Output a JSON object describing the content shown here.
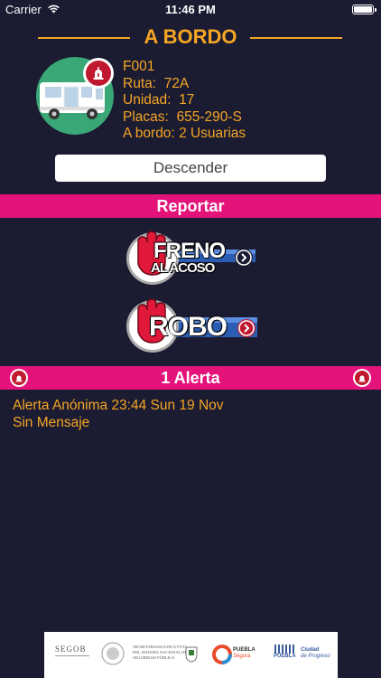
{
  "status_bar": {
    "carrier": "Carrier",
    "time": "11:46 PM"
  },
  "header": {
    "title": "A BORDO"
  },
  "trip": {
    "code": "F001",
    "ruta_label": "Ruta:",
    "ruta": "72A",
    "unidad_label": "Unidad:",
    "unidad": "17",
    "placas_label": "Placas:",
    "placas": "655-290-S",
    "abordo_label": "A bordo:",
    "abordo": "2 Usuarias"
  },
  "actions": {
    "descender": "Descender"
  },
  "report": {
    "title": "Reportar",
    "freno_line1": "FRENO",
    "freno_line2": "AL ACOSO",
    "robo": "ROBO"
  },
  "alerts": {
    "count_label": "1 Alerta",
    "items": [
      {
        "line1": "Alerta Anónima 23:44 Sun 19 Nov",
        "line2": "Sin Mensaje"
      }
    ]
  },
  "footer": {
    "logos": {
      "segob": "SEGOB",
      "secretariado_1": "SECRETARIADO EJECUTIVO",
      "secretariado_2": "DEL SISTEMA NACIONAL DE",
      "secretariado_3": "SEGURIDAD PÚBLICA",
      "puebla_segura_1": "PUEBLA",
      "puebla_segura_2": "Segura",
      "puebla": "PUEBLA",
      "ciudad_1": "Ciudad",
      "ciudad_2": "de Progreso"
    }
  },
  "colors": {
    "background": "#1b1b32",
    "accent": "#f5a623",
    "pink": "#e3137a",
    "green": "#3aa776",
    "red": "#c0192f"
  }
}
